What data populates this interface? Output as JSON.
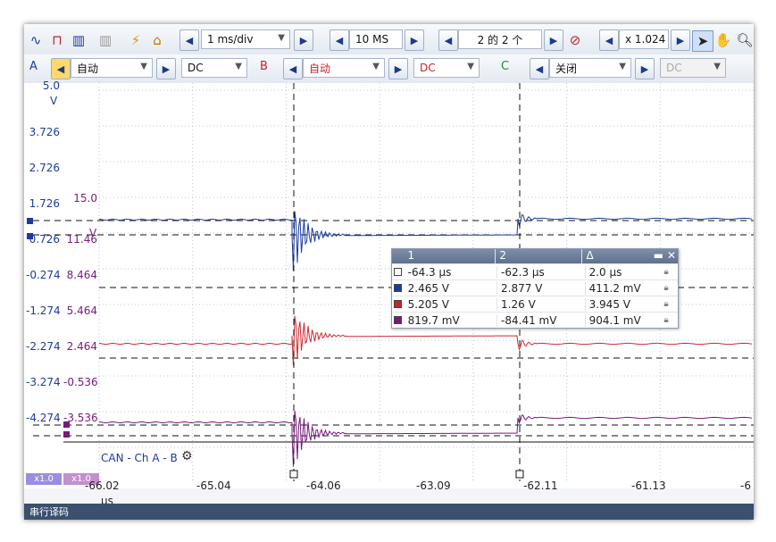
{
  "toolbar1": {
    "timebase": "1 ms/div",
    "samples": "10 MS",
    "buffer": "2 的 2 个",
    "zoom": "x 1.024"
  },
  "toolbar2": {
    "channel_a": {
      "label": "A",
      "range": "自动",
      "coupling": "DC",
      "color": "#1b3ba0"
    },
    "channel_b": {
      "label": "B",
      "range": "自动",
      "coupling": "DC",
      "color": "#c0262c"
    },
    "channel_c": {
      "label": "C",
      "range": "关闭",
      "coupling": "DC",
      "color": "#2a8a2a"
    }
  },
  "plot": {
    "unit_a": "V",
    "unit_b": "V",
    "y_ticks_a": [
      "5.0",
      "3.726",
      "2.726",
      "1.726",
      "0.726",
      "-0.274",
      "-1.274",
      "-2.274",
      "-3.274",
      "-4.274"
    ],
    "y_ticks_b": [
      "15.0",
      "11.46",
      "8.464",
      "5.464",
      "2.464",
      "-0.536",
      "-3.536"
    ],
    "x_ticks": [
      "-66.02",
      "-65.04",
      "-64.06",
      "-63.09",
      "-62.11",
      "-61.13",
      "-6"
    ],
    "x_unit": "µs",
    "decoder_label": "CAN - Ch A - B",
    "scale_a": "x1.0",
    "scale_b": "x1.0",
    "ruler1_label": "1",
    "ruler2_label": "2"
  },
  "measure_table": {
    "headers": [
      "1",
      "2",
      "Δ"
    ],
    "rows": [
      {
        "color": "#ffffff",
        "v1": "-64.3 µs",
        "v2": "-62.3 µs",
        "d": "2.0 µs"
      },
      {
        "color": "#1b3ba0",
        "v1": "2.465 V",
        "v2": "2.877 V",
        "d": "411.2 mV"
      },
      {
        "color": "#c0262c",
        "v1": "5.205 V",
        "v2": "1.26 V",
        "d": "3.945 V"
      },
      {
        "color": "#7a1a7a",
        "v1": "819.7 mV",
        "v2": "-84.41 mV",
        "d": "904.1 mV"
      }
    ]
  },
  "status": {
    "text": "串行译码"
  },
  "colors": {
    "blue": "#1b3ba0",
    "red": "#d02a30",
    "purple": "#7a1a7a",
    "grid": "#b8c8dc"
  }
}
